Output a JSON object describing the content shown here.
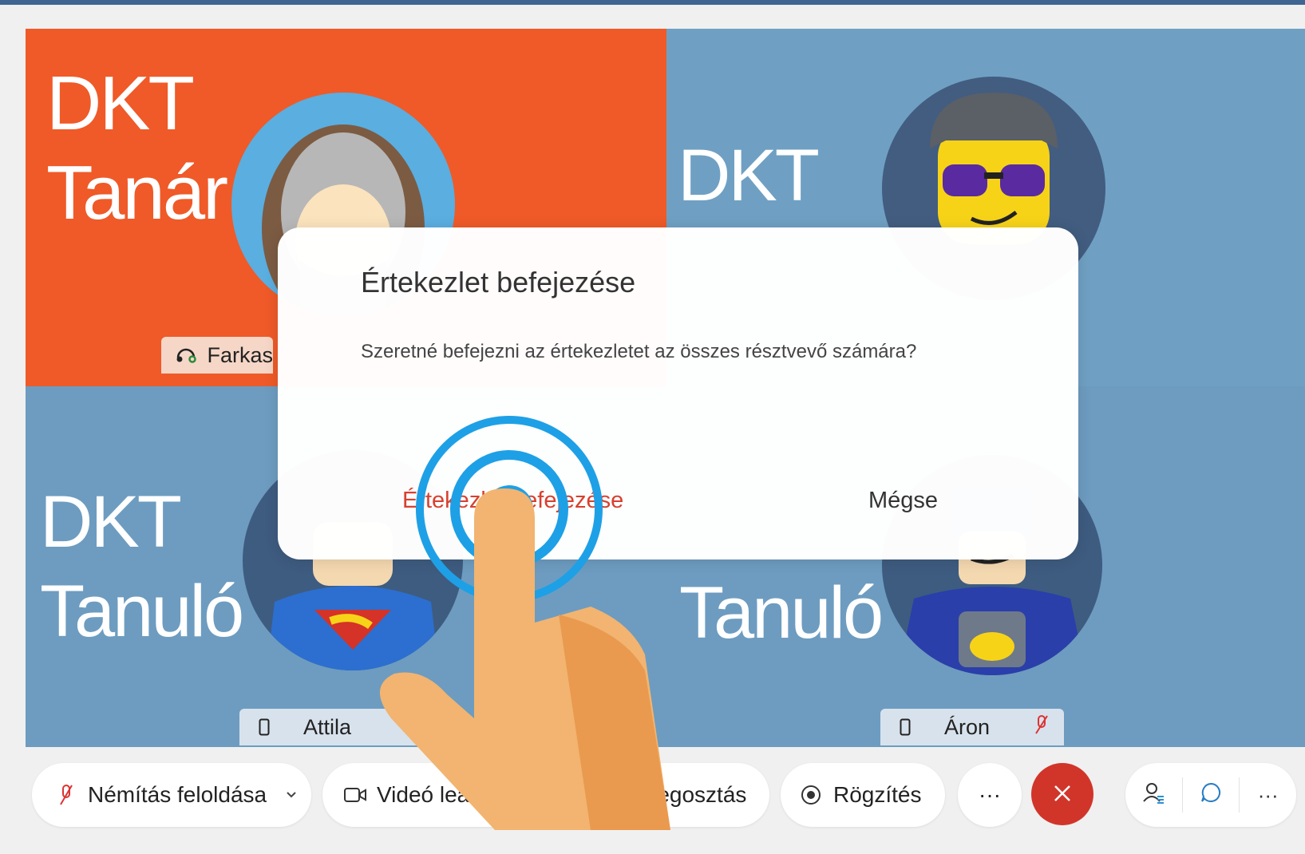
{
  "tiles": {
    "teacher": {
      "name": "DKT\nTanár",
      "participant": "Farkas"
    },
    "top_right": {
      "name": "DKT"
    },
    "bottom_left": {
      "name": "DKT\nTanuló",
      "participant": "Attila"
    },
    "bottom_right": {
      "name": "Tanuló",
      "participant": "Áron"
    }
  },
  "dialog": {
    "title": "Értekezlet befejezése",
    "message": "Szeretné befejezni az értekezletet az összes résztvevő számára?",
    "confirm_label": "Értekezlet befejezése",
    "cancel_label": "Mégse"
  },
  "toolbar": {
    "unmute_label": "Némítás feloldása",
    "video_label": "Videó leállítása",
    "share_label": "Megosztás",
    "record_label": "Rögzítés",
    "more_label": "···",
    "right_more_label": "···"
  },
  "colors": {
    "teacher_tile": "#ef5a28",
    "student_tile": "#6d9cc0",
    "end_call": "#d1352a",
    "dialog_confirm": "#d8402f",
    "ripple": "#1ea0e6",
    "hand": "#f2b470"
  },
  "icons": [
    "headset-icon",
    "phone-icon",
    "mic-off-icon",
    "chevron-down-icon",
    "video-icon",
    "share-icon",
    "record-icon",
    "close-icon",
    "participants-icon",
    "chat-icon",
    "more-icon"
  ]
}
